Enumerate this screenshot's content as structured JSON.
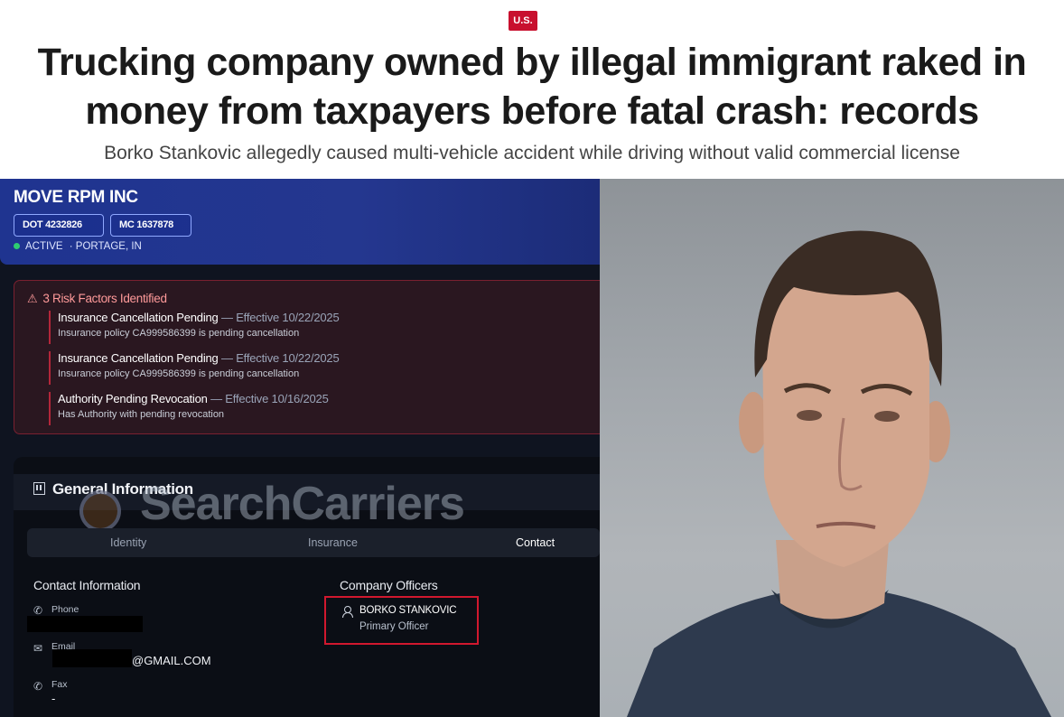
{
  "article": {
    "section_tag": "U.S.",
    "headline_line1": "Trucking company owned by illegal immigrant raked in",
    "headline_line2": "money from taxpayers before fatal crash: records",
    "subheadline": "Borko Stankovic allegedly caused multi-vehicle accident while driving without valid commercial license"
  },
  "carrier": {
    "name": "MOVE RPM INC",
    "dot": "DOT 4232826",
    "mc": "MC 1637878",
    "status": "ACTIVE",
    "location": "· PORTAGE, IN",
    "status_color": "#2ecc71"
  },
  "risks": {
    "title": "3 Risk Factors Identified",
    "items": [
      {
        "name": "Insurance Cancellation Pending",
        "effective": " — Effective 10/22/2025",
        "detail": "Insurance policy CA999586399 is pending cancellation"
      },
      {
        "name": "Insurance Cancellation Pending",
        "effective": " — Effective 10/22/2025",
        "detail": "Insurance policy CA999586399 is pending cancellation"
      },
      {
        "name": "Authority Pending Revocation",
        "effective": " — Effective 10/16/2025",
        "detail": "Has Authority with pending revocation"
      }
    ]
  },
  "general": {
    "title": "General Information",
    "watermark": "SearchCarriers",
    "tabs": [
      "Identity",
      "Insurance",
      "Contact"
    ],
    "active_tab": "Contact",
    "contact_title": "Contact Information",
    "phone_label": "Phone",
    "email_label": "Email",
    "email_suffix": "@GMAIL.COM",
    "fax_label": "Fax",
    "fax_value": "-",
    "officers_title": "Company Officers",
    "officer_name": "BORKO STANKOVIC",
    "officer_role": "Primary Officer"
  },
  "colors": {
    "tag_red": "#c8102e",
    "header_blue": "#24378f",
    "highlight_red": "#d1182e"
  }
}
